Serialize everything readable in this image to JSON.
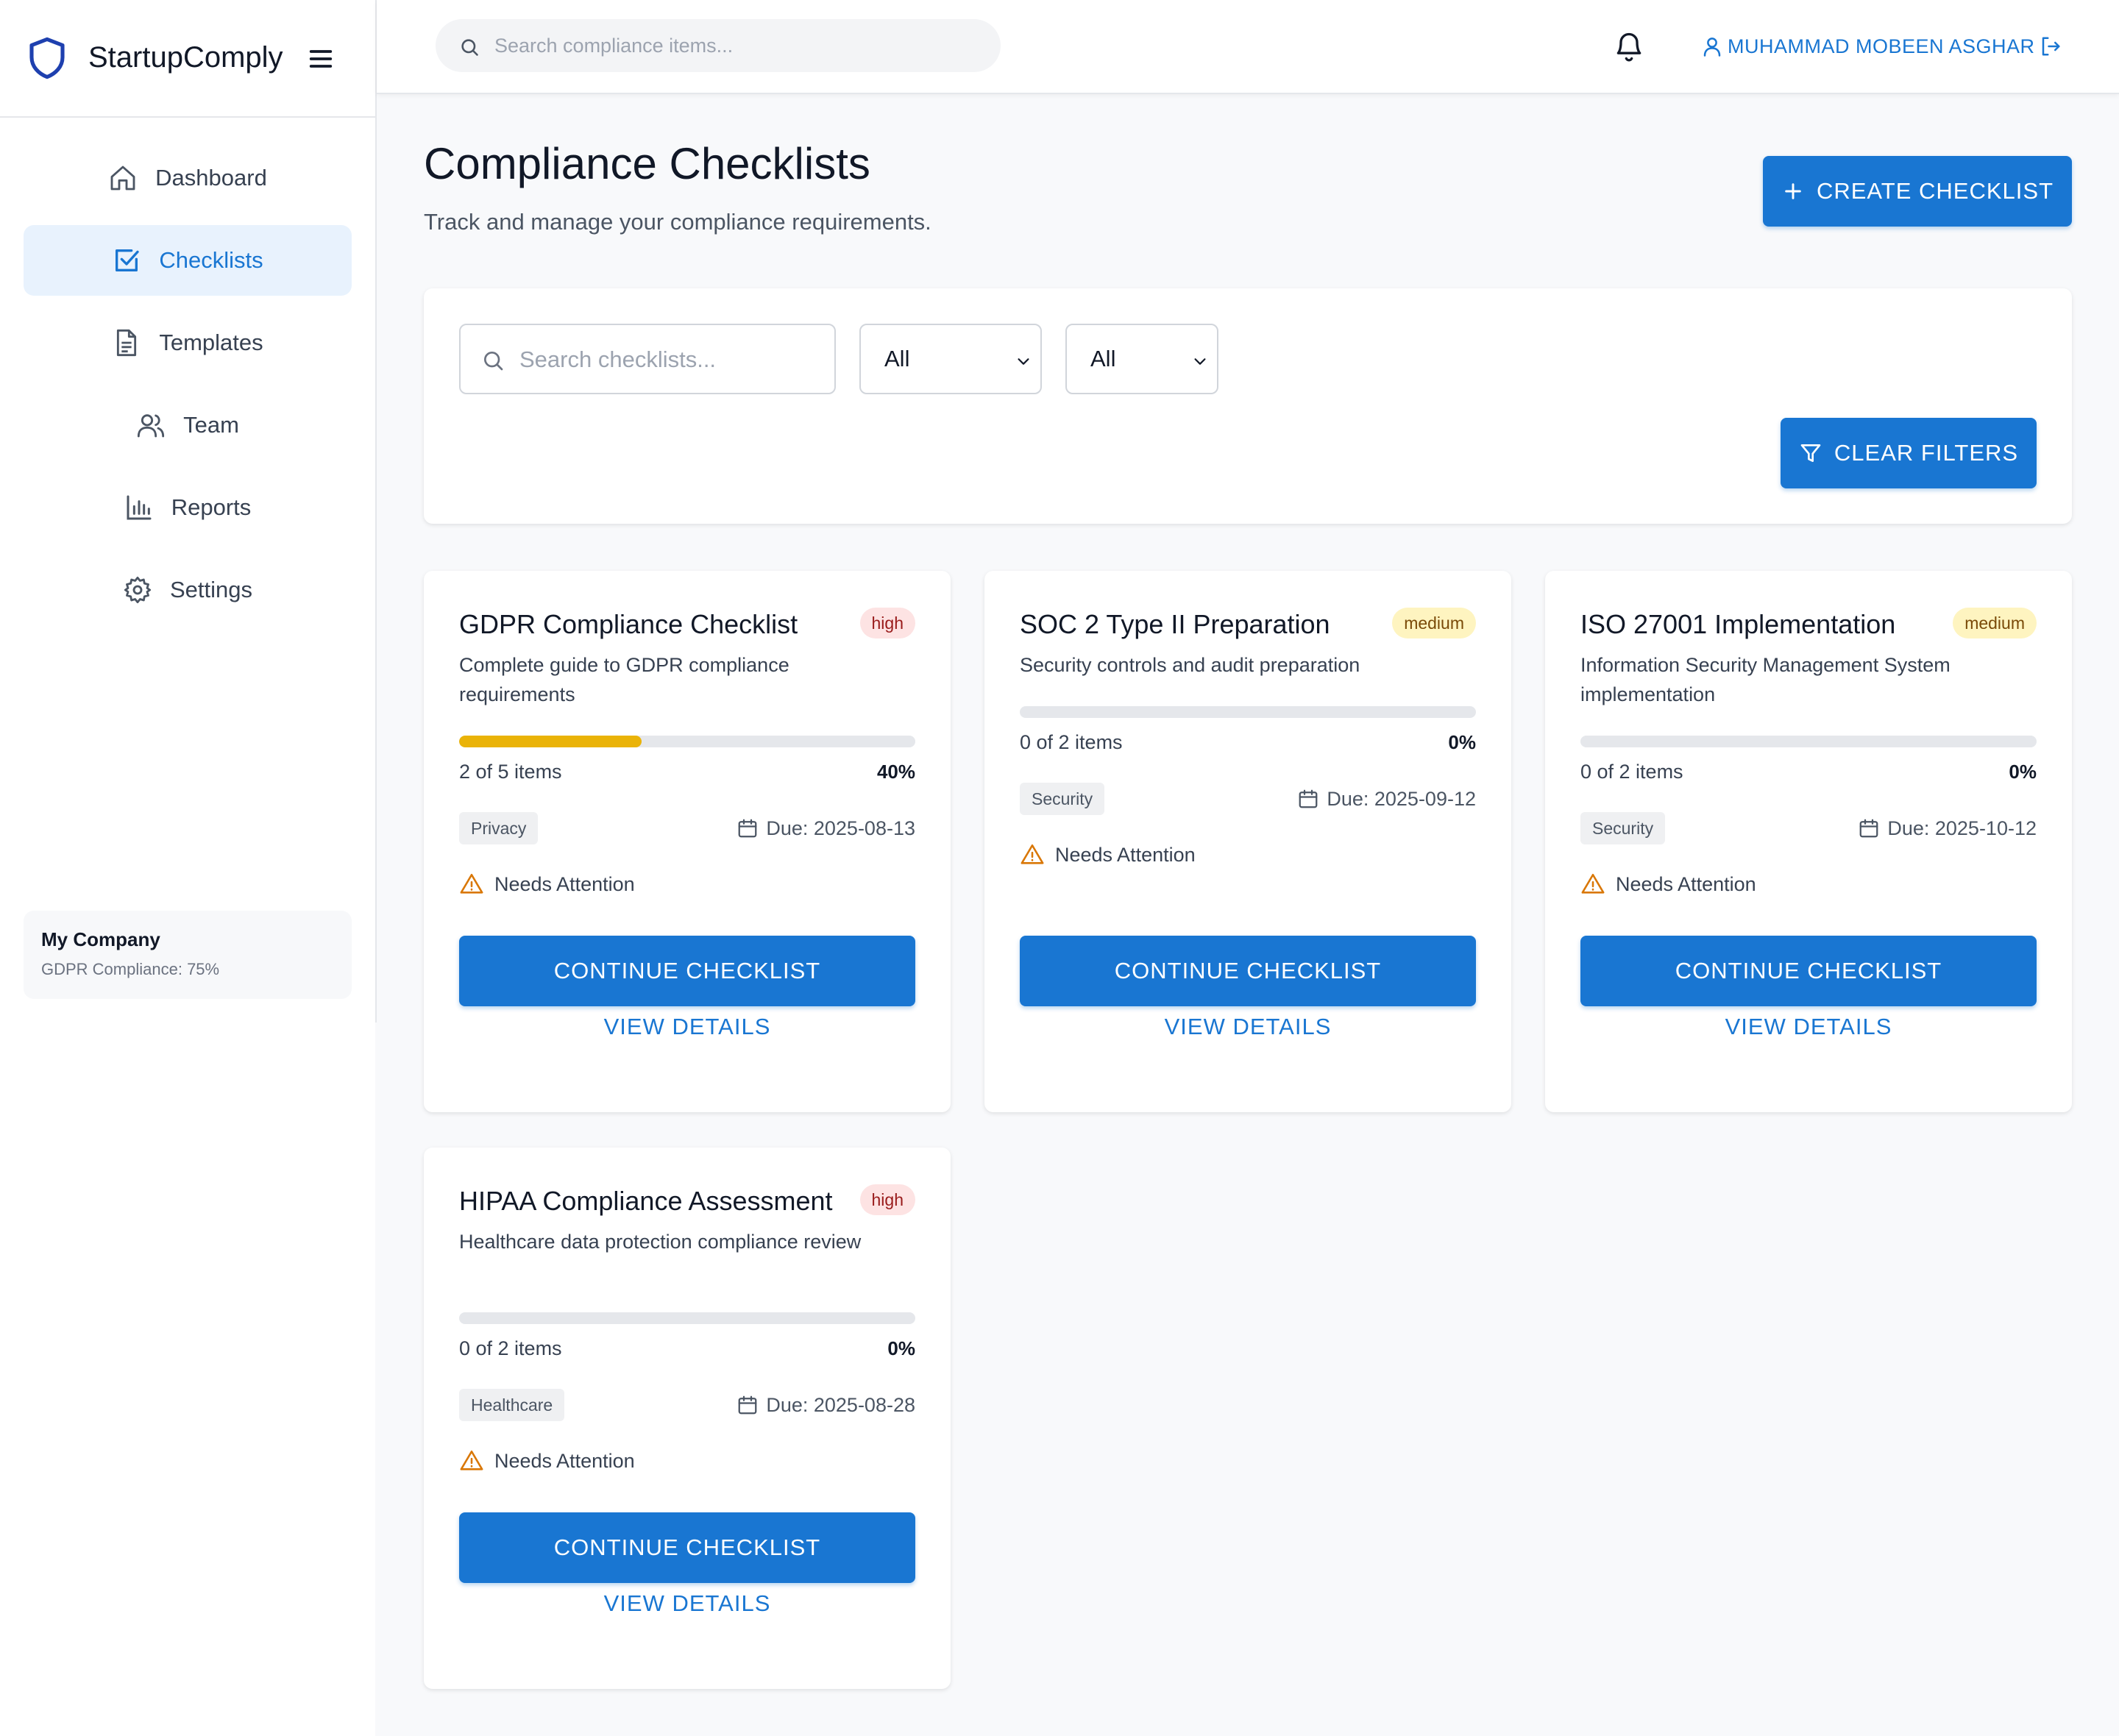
{
  "app": {
    "name": "StartupComply"
  },
  "sidebar": {
    "items": [
      {
        "label": "Dashboard",
        "icon": "home-icon"
      },
      {
        "label": "Checklists",
        "icon": "checkbox-icon",
        "active": true
      },
      {
        "label": "Templates",
        "icon": "document-icon"
      },
      {
        "label": "Team",
        "icon": "users-icon"
      },
      {
        "label": "Reports",
        "icon": "bar-chart-icon"
      },
      {
        "label": "Settings",
        "icon": "gear-icon"
      }
    ],
    "company": {
      "name": "My Company",
      "status": "GDPR Compliance: 75%"
    }
  },
  "topbar": {
    "search_placeholder": "Search compliance items...",
    "user_name": "MUHAMMAD MOBEEN ASGHAR"
  },
  "page": {
    "title": "Compliance Checklists",
    "subtitle": "Track and manage your compliance requirements.",
    "create_label": "CREATE CHECKLIST"
  },
  "filters": {
    "search_placeholder": "Search checklists...",
    "filter1_value": "All",
    "filter2_value": "All",
    "clear_label": "CLEAR FILTERS"
  },
  "colors": {
    "accent": "#1976d2",
    "progress": "#eab308",
    "warning": "#d97706"
  },
  "checklists": [
    {
      "title": "GDPR Compliance Checklist",
      "priority": "high",
      "description": "Complete guide to GDPR compliance requirements",
      "progress": 0.4,
      "items_text": "2 of 5 items",
      "percent": "40%",
      "category": "Privacy",
      "due": "Due: 2025-08-13",
      "status": "Needs Attention",
      "continue_label": "CONTINUE CHECKLIST",
      "view_label": "VIEW DETAILS"
    },
    {
      "title": "SOC 2 Type II Preparation",
      "priority": "medium",
      "description": "Security controls and audit preparation",
      "progress": 0,
      "items_text": "0 of 2 items",
      "percent": "0%",
      "category": "Security",
      "due": "Due: 2025-09-12",
      "status": "Needs Attention",
      "continue_label": "CONTINUE CHECKLIST",
      "view_label": "VIEW DETAILS"
    },
    {
      "title": "ISO 27001 Implementation",
      "priority": "medium",
      "description": "Information Security Management System implementation",
      "progress": 0,
      "items_text": "0 of 2 items",
      "percent": "0%",
      "category": "Security",
      "due": "Due: 2025-10-12",
      "status": "Needs Attention",
      "continue_label": "CONTINUE CHECKLIST",
      "view_label": "VIEW DETAILS"
    },
    {
      "title": "HIPAA Compliance Assessment",
      "priority": "high",
      "description": "Healthcare data protection compliance review",
      "progress": 0,
      "items_text": "0 of 2 items",
      "percent": "0%",
      "category": "Healthcare",
      "due": "Due: 2025-08-28",
      "status": "Needs Attention",
      "continue_label": "CONTINUE CHECKLIST",
      "view_label": "VIEW DETAILS"
    }
  ]
}
